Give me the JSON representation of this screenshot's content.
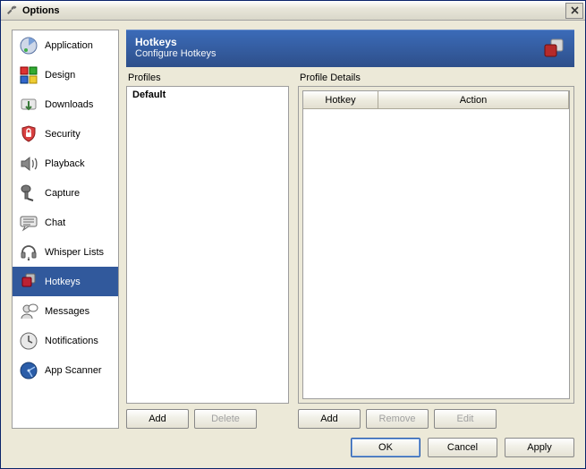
{
  "window": {
    "title": "Options"
  },
  "sidebar": {
    "items": [
      {
        "label": "Application"
      },
      {
        "label": "Design"
      },
      {
        "label": "Downloads"
      },
      {
        "label": "Security"
      },
      {
        "label": "Playback"
      },
      {
        "label": "Capture"
      },
      {
        "label": "Chat"
      },
      {
        "label": "Whisper Lists"
      },
      {
        "label": "Hotkeys"
      },
      {
        "label": "Messages"
      },
      {
        "label": "Notifications"
      },
      {
        "label": "App Scanner"
      }
    ]
  },
  "header": {
    "title": "Hotkeys",
    "subtitle": "Configure Hotkeys"
  },
  "profiles": {
    "label": "Profiles",
    "items": [
      {
        "name": "Default"
      }
    ],
    "buttons": {
      "add": "Add",
      "delete": "Delete"
    }
  },
  "details": {
    "label": "Profile Details",
    "columns": {
      "hotkey": "Hotkey",
      "action": "Action"
    },
    "rows": [],
    "buttons": {
      "add": "Add",
      "remove": "Remove",
      "edit": "Edit"
    }
  },
  "footer": {
    "ok": "OK",
    "cancel": "Cancel",
    "apply": "Apply"
  }
}
